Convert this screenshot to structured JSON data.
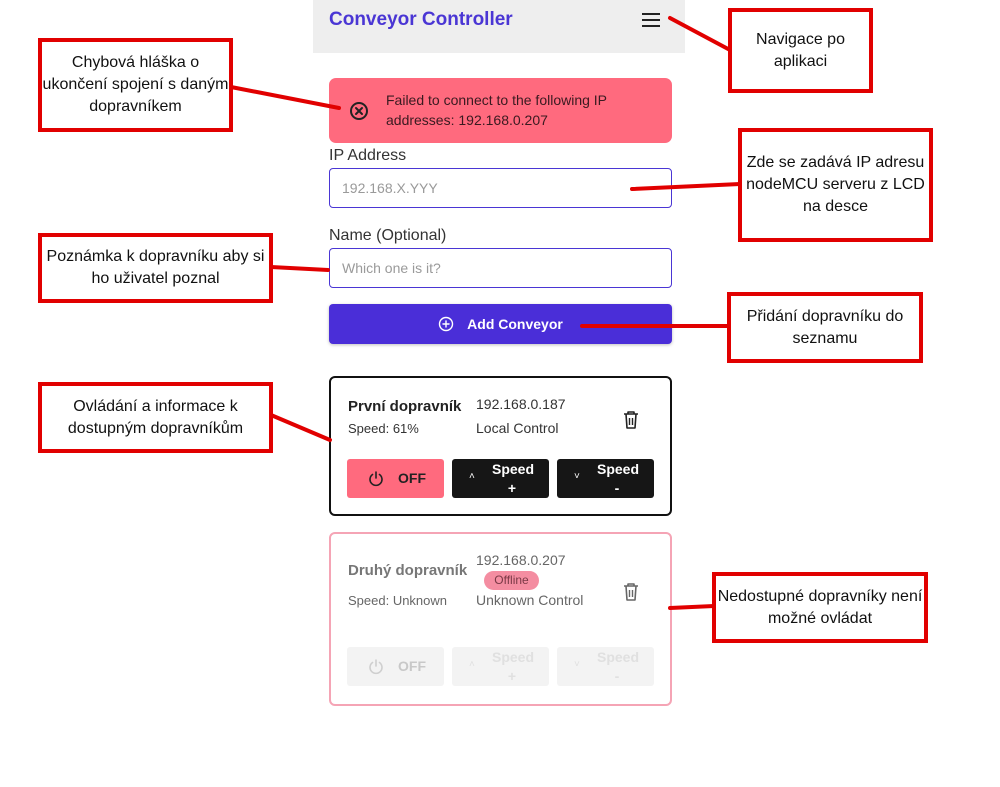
{
  "app": {
    "title": "Conveyor Controller",
    "accent_color": "#4a36d4",
    "menu_icon": "hamburger-menu-icon"
  },
  "error_banner": {
    "icon": "x-circle-icon",
    "message": "Failed to connect to the following IP addresses: 192.168.0.207",
    "color": "#ff6a7e"
  },
  "form": {
    "ip_label": "IP Address",
    "ip_placeholder": "192.168.X.YYY",
    "ip_value": "",
    "name_label": "Name (Optional)",
    "name_placeholder": "Which one is it?",
    "name_value": "",
    "add_button_label": "Add Conveyor",
    "add_button_icon": "plus-circle-icon"
  },
  "conveyors": [
    {
      "name": "První dopravník",
      "ip": "192.168.0.187",
      "speed": "Speed: 61%",
      "control": "Local Control",
      "status": "",
      "off_label": "OFF",
      "speed_up_label_1": "Speed",
      "speed_up_label_2": "+",
      "speed_down_label_1": "Speed",
      "speed_down_label_2": "-"
    },
    {
      "name": "Druhý dopravník",
      "ip": "192.168.0.207",
      "speed": "Speed: Unknown",
      "control": "Unknown Control",
      "status": "Offline",
      "off_label": "OFF",
      "speed_up_label_1": "Speed",
      "speed_up_label_2": "+",
      "speed_down_label_1": "Speed",
      "speed_down_label_2": "-"
    }
  ],
  "annotations": {
    "navigation": "Navigace po aplikaci",
    "error": "Chybová hláška o ukončení spojení s daným dopravníkem",
    "ip_input": "Zde se zadává IP adresu nodeMCU serveru z LCD na desce",
    "name_note": "Poznámka k dopravníku aby si ho uživatel poznal",
    "add": "Přidání dopravníku do seznamu",
    "controls": "Ovládání a informace k dostupným dopravníkům",
    "unavailable": "Nedostupné dopravníky není možné ovládat",
    "color": "#e10000"
  }
}
